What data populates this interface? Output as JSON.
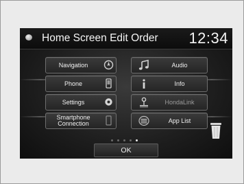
{
  "screen": {
    "title": "Home Screen Edit Order",
    "clock": "12:34"
  },
  "tiles": {
    "left": [
      {
        "label": "Navigation",
        "icon": "navigation-icon"
      },
      {
        "label": "Phone",
        "icon": "phone-icon"
      },
      {
        "label": "Settings",
        "icon": "settings-icon"
      },
      {
        "label_line1": "Smartphone",
        "label_line2": "Connection",
        "icon": "smartphone-icon"
      }
    ],
    "right": [
      {
        "label": "Audio",
        "icon": "music-note-icon"
      },
      {
        "label": "Info",
        "icon": "info-icon"
      },
      {
        "label": "HondaLink",
        "icon": "hondalink-icon"
      },
      {
        "label": "App List",
        "icon": "app-list-icon"
      }
    ]
  },
  "pager": {
    "pages": 5,
    "active_page": 5
  },
  "ok_button": {
    "label": "OK"
  },
  "colors": {
    "screen_bg": "#1f1f1f",
    "tile_border": "#6e6e6e",
    "text": "#f0f0f0"
  }
}
